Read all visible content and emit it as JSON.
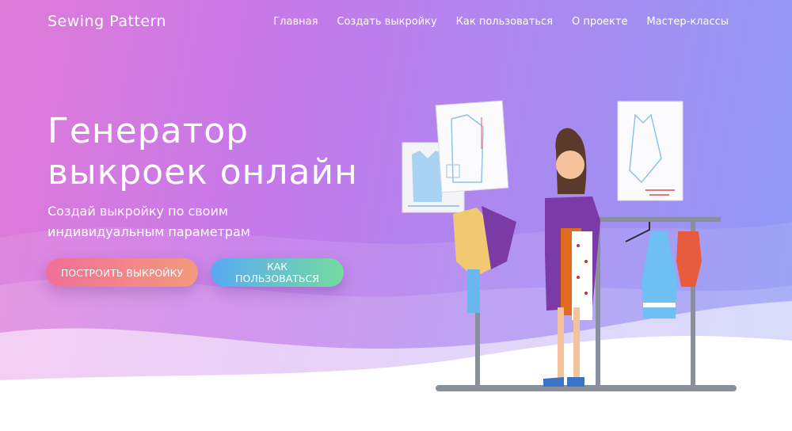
{
  "header": {
    "logo": "Sewing Pattern",
    "nav": [
      {
        "label": "Главная"
      },
      {
        "label": "Создать выкройку"
      },
      {
        "label": "Как пользоваться"
      },
      {
        "label": "О проекте"
      },
      {
        "label": "Мастер-классы"
      }
    ]
  },
  "hero": {
    "title_line1": "Генератор",
    "title_line2": "выкроек онлайн",
    "subtitle_line1": "Создай выкройку по своим",
    "subtitle_line2": "индивидуальным параметрам",
    "btn_build": "ПОСТРОИТЬ ВЫКРОЙКУ",
    "btn_how": "КАК ПОЛЬЗОВАТЬСЯ"
  },
  "colors": {
    "gradient_left": "#e07ad8",
    "gradient_right": "#8f9bf6",
    "btn_build_gradient": [
      "#f26f97",
      "#f29a7b"
    ],
    "btn_how_gradient": [
      "#59a9f4",
      "#74dba0"
    ]
  }
}
